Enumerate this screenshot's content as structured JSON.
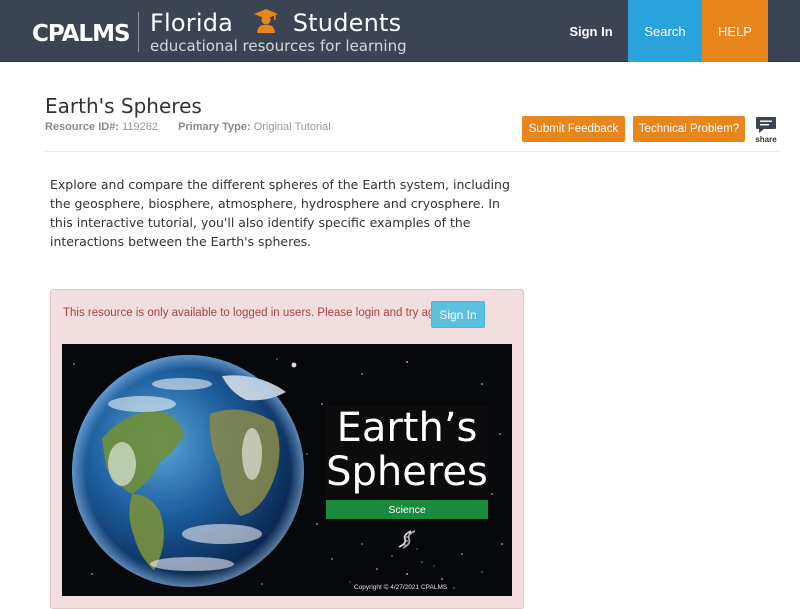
{
  "header": {
    "logo_text": "CPALMS",
    "title_left": "Florida",
    "title_right": "Students",
    "subtitle": "educational resources for learning",
    "student_icon": "student-graduate-icon",
    "nav": {
      "signin": "Sign In",
      "search": "Search",
      "help": "HELP"
    },
    "colors": {
      "background": "#3c4352",
      "search": "#2aa3dd",
      "help": "#e7861c",
      "student_icon": "#e7861c"
    }
  },
  "resource": {
    "title": "Earth's Spheres",
    "id_label": "Resource ID#:",
    "id_value": "119262",
    "type_label": "Primary Type:",
    "type_value": "Original Tutorial",
    "submit_feedback": "Submit Feedback",
    "technical_problem": "Technical Problem?",
    "share_label": "share",
    "share_icon": "comment-bubble-icon",
    "description": "Explore and compare the different spheres of the Earth system, including the geosphere, biosphere, atmosphere, hydrosphere and cryosphere. In this interactive tutorial, you'll also identify specific examples of the interactions between the Earth's spheres."
  },
  "alert": {
    "message": "This resource is only available to logged in users. Please login and try again.",
    "signin_label": "Sign In",
    "colors": {
      "background": "#f2dede",
      "text": "#a94442",
      "button": "#5bc0de"
    }
  },
  "banner": {
    "title_line1": "Earth’s",
    "title_line2": "Spheres",
    "subject": "Science",
    "copyright": "Copyright © 4/27/2021 CPALMS",
    "dna_icon": "dna-helix-icon",
    "earth_image": "earth-globe-image",
    "colors": {
      "subject": "#1a8a3d"
    }
  }
}
